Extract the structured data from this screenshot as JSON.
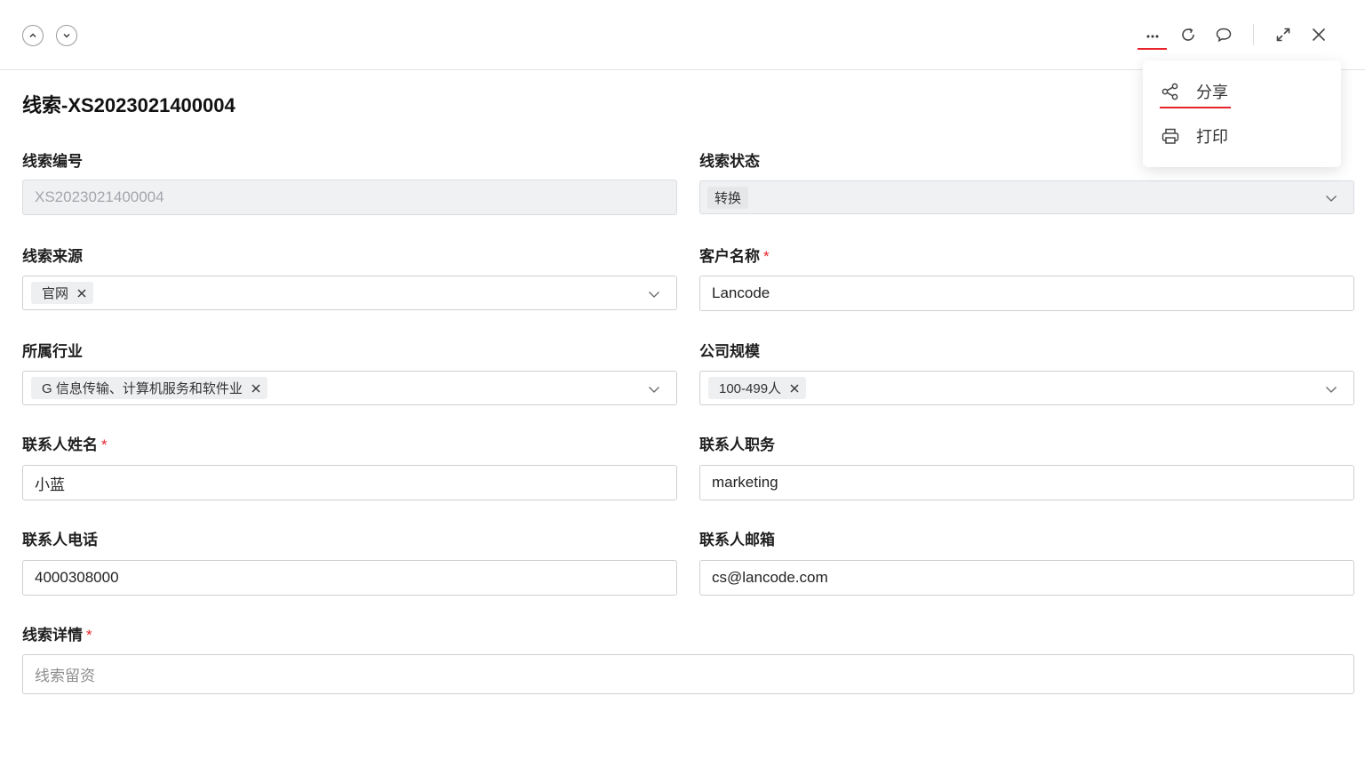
{
  "header": {
    "prev_icon": "chevron-up-icon",
    "next_icon": "chevron-down-icon",
    "more_icon": "more-horizontal-icon",
    "refresh_icon": "refresh-icon",
    "comment_icon": "comment-icon",
    "expand_icon": "expand-icon",
    "close_icon": "close-icon"
  },
  "title": "线索-XS2023021400004",
  "fields": {
    "lead_no": {
      "label": "线索编号",
      "value": "XS2023021400004"
    },
    "lead_status": {
      "label": "线索状态",
      "value": "转换"
    },
    "lead_source": {
      "label": "线索来源",
      "tag": "官网"
    },
    "customer_name": {
      "label": "客户名称",
      "required": "*",
      "value": "Lancode"
    },
    "industry": {
      "label": "所属行业",
      "tag": "G 信息传输、计算机服务和软件业"
    },
    "company_size": {
      "label": "公司规模",
      "tag": "100-499人"
    },
    "contact_name": {
      "label": "联系人姓名",
      "required": "*",
      "value": "小蓝"
    },
    "contact_title": {
      "label": "联系人职务",
      "value": "marketing"
    },
    "contact_phone": {
      "label": "联系人电话",
      "value": "4000308000"
    },
    "contact_email": {
      "label": "联系人邮箱",
      "value": "cs@lancode.com"
    },
    "lead_detail": {
      "label": "线索详情",
      "required": "*",
      "placeholder": "线索留资"
    }
  },
  "menu": {
    "items": [
      {
        "label": "分享",
        "icon": "share-icon"
      },
      {
        "label": "打印",
        "icon": "printer-icon"
      }
    ]
  },
  "colors": {
    "accent": "#e8242a",
    "border": "#cfcfcf",
    "disabled_bg": "#f0f1f3"
  }
}
